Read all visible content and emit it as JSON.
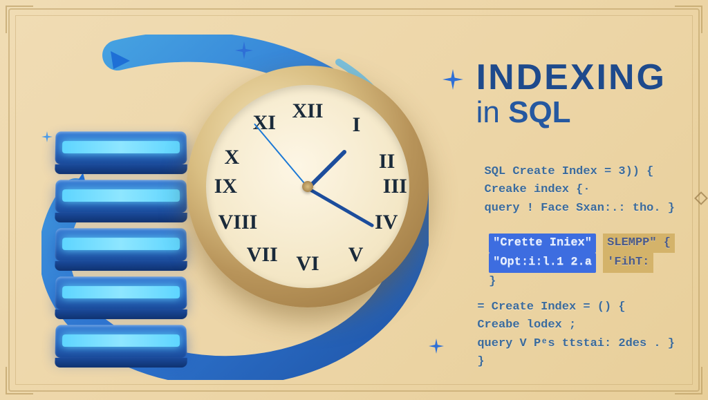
{
  "title": {
    "main": "INDEXING",
    "sub_prefix": "in ",
    "sub_word": "SQL"
  },
  "clock": {
    "numerals": [
      "XII",
      "I",
      "II",
      "III",
      "IV",
      "V",
      "VI",
      "VII",
      "VIII",
      "IX",
      "X",
      "XI"
    ]
  },
  "code_block_1": {
    "l1": "SQL Create  Index  =  3))   {",
    "l2": " Creake  index    {·",
    "l3": " query ! Face Sxan:.: tho.  }"
  },
  "code_block_2": {
    "hl1a": "\"Crette Iniex\"",
    "hl1b": "SLEMPP\" {",
    "hl2a": "\"Opt:i:l.1 2.a",
    "hl2b": "'FihT:",
    "l3": "}"
  },
  "code_block_3": {
    "l1": "= Create  Index  =  ()   {",
    "l2": "  Creabe  lodex    ;",
    "l3": "  query V Pᵉs ttstai: 2des . }",
    "l4": "}"
  }
}
